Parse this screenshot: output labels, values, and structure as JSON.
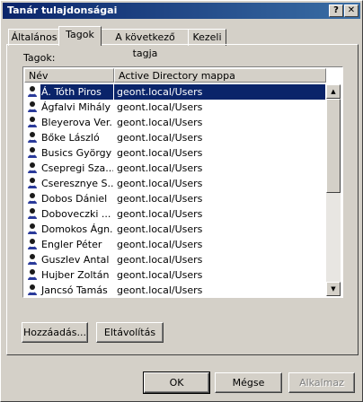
{
  "window": {
    "title": "Tanár tulajdonságai",
    "help_glyph": "?",
    "close_glyph": "✕"
  },
  "tabs": [
    {
      "label": "Általános"
    },
    {
      "label": "Tagok"
    },
    {
      "label": "A következő tagja"
    },
    {
      "label": "Kezeli"
    }
  ],
  "members": {
    "label": "Tagok:",
    "columns": {
      "name": "Név",
      "path": "Active Directory mappa"
    },
    "rows": [
      {
        "name": "Á. Tóth Piros",
        "path": "geont.local/Users",
        "selected": true
      },
      {
        "name": "Ágfalvi Mihály",
        "path": "geont.local/Users"
      },
      {
        "name": "Bleyerova Ver...",
        "path": "geont.local/Users"
      },
      {
        "name": "Bőke László",
        "path": "geont.local/Users"
      },
      {
        "name": "Busics György",
        "path": "geont.local/Users"
      },
      {
        "name": "Csepregi Sza...",
        "path": "geont.local/Users"
      },
      {
        "name": "Cseresznye S...",
        "path": "geont.local/Users"
      },
      {
        "name": "Dobos Dániel",
        "path": "geont.local/Users"
      },
      {
        "name": "Doboveczki ...",
        "path": "geont.local/Users"
      },
      {
        "name": "Domokos Ágn...",
        "path": "geont.local/Users"
      },
      {
        "name": "Engler Péter",
        "path": "geont.local/Users"
      },
      {
        "name": "Guszlev Antal",
        "path": "geont.local/Users"
      },
      {
        "name": "Hujber Zoltán",
        "path": "geont.local/Users"
      },
      {
        "name": "Jancsó Tamás",
        "path": "geont.local/Users"
      }
    ]
  },
  "buttons": {
    "add": "Hozzáadás...",
    "remove": "Eltávolítás",
    "ok": "OK",
    "cancel": "Mégse",
    "apply": "Alkalmaz"
  },
  "icons": {
    "user": "user-icon",
    "scroll_up": "▲",
    "scroll_down": "▼"
  },
  "colors": {
    "title_start": "#0a246a",
    "title_end": "#3a6ea5",
    "selection": "#0a246a",
    "face": "#d4d0c8"
  }
}
